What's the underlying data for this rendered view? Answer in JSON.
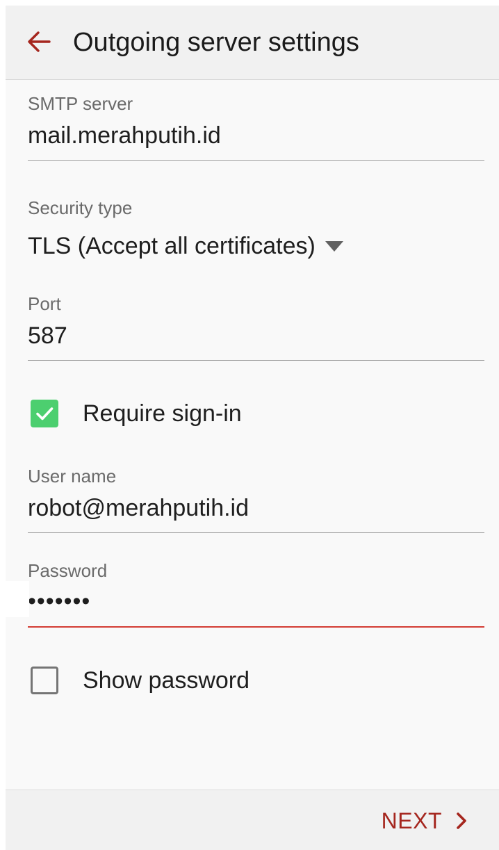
{
  "header": {
    "title": "Outgoing server settings",
    "back_icon": "arrow-left-icon"
  },
  "smtp_server": {
    "label": "SMTP server",
    "value": "mail.merahputih.id"
  },
  "security_type": {
    "label": "Security type",
    "value": "TLS (Accept all certificates)",
    "dropdown_icon": "caret-down-icon"
  },
  "port": {
    "label": "Port",
    "value": "587"
  },
  "require_signin": {
    "label": "Require sign-in",
    "checked": true
  },
  "user_name": {
    "label": "User name",
    "value": "robot@merahputih.id"
  },
  "password": {
    "label": "Password",
    "masked_value": "•••••••"
  },
  "show_password": {
    "label": "Show password",
    "checked": false
  },
  "footer": {
    "next_label": "NEXT",
    "next_icon": "chevron-right-icon"
  },
  "colors": {
    "accent": "#a5261e",
    "active_underline": "#d33c34",
    "checkbox_checked": "#4ccf6f"
  }
}
